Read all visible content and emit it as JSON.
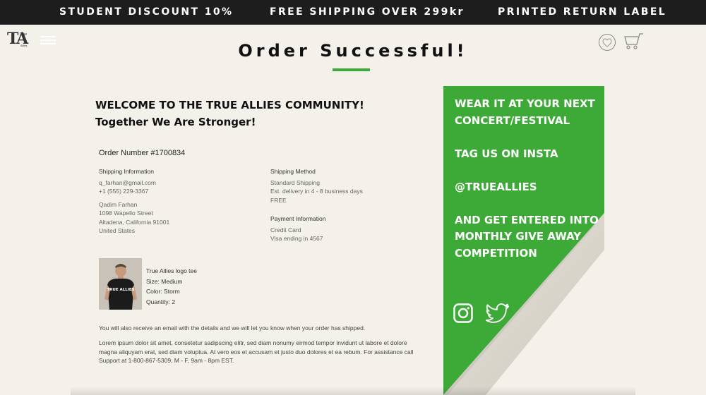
{
  "promo": {
    "items": [
      "STUDENT DISCOUNT 10%",
      "FREE SHIPPING OVER 299kr",
      "PRINTED RETURN LABEL"
    ]
  },
  "header": {
    "logo_text": "TA",
    "logo_small_top": "True",
    "logo_small_bottom": "Allies"
  },
  "page": {
    "title": "Order Successful!"
  },
  "welcome": {
    "line1": "WELCOME TO THE TRUE ALLIES COMMUNITY!",
    "line2": "Together We Are Stronger!"
  },
  "order": {
    "number_text": "Order Number #1700834",
    "shipping_info": {
      "heading": "Shipping Information",
      "email": "q_farhan@gmail.com",
      "phone": "+1 (555) 229-3367",
      "name": "Qadim Farhan",
      "street": "1098 Wapello Street",
      "city": "Altadena, California 91001",
      "country": "United States"
    },
    "shipping_method": {
      "heading": "Shipping Method",
      "type": "Standard Shipping",
      "delivery": "Est. delivery in 4 - 8 business days",
      "cost": "FREE"
    },
    "payment_info": {
      "heading": "Payment Information",
      "method": "Credit Card",
      "detail": "Visa ending in 4567"
    },
    "product": {
      "name": "True Allies logo tee",
      "size": "Size: Medium",
      "color": "Color: Storm",
      "quantity": "Quantity: 2",
      "shirt_text": "TRUE ALLIES"
    },
    "email_note": "You will also receive an email with the details and we will let you know when your order has shipped.",
    "lorem_note": "Lorem ipsum dolor sit amet, consetetur sadipscing elitr, sed diam nonumy eirmod tempor invidunt ut labore et dolore magna aliquyam erat, sed diam voluptua. At vero eos et accusam et justo duo dolores et ea rebum. For assistance call Support at 1-800-867-5309, M - F, 9am - 8pm EST."
  },
  "promo_panel": {
    "line1": "WEAR IT AT YOUR NEXT CONCERT/FESTIVAL",
    "line2": "TAG US ON INSTA",
    "line3": "@TRUEALLIES",
    "line4": "AND GET ENTERED INTO MONTHLY GIVE AWAY COMPETITION"
  },
  "icons": {
    "menu": "hamburger-menu-icon",
    "wishlist": "heart-icon",
    "cart": "shopping-cart-icon",
    "instagram": "instagram-icon",
    "twitter": "twitter-icon"
  },
  "colors": {
    "accent_green": "#3daa37",
    "top_bar": "#1d1d1d",
    "background": "#f4f1ea"
  }
}
